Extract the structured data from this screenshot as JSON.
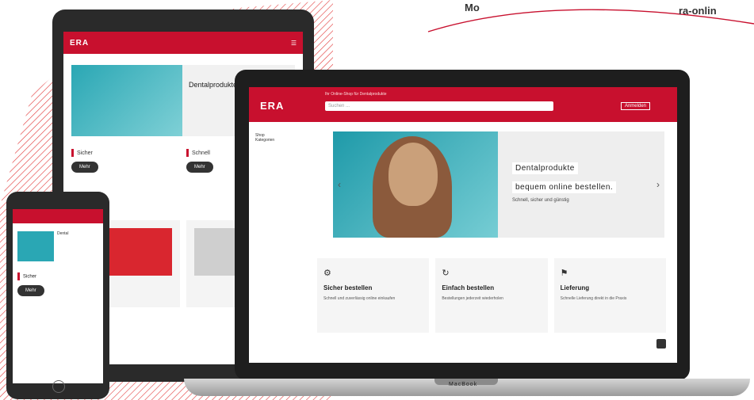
{
  "banner_text": {
    "left": "Mo",
    "right": "ra-onlin"
  },
  "colors": {
    "brand_red": "#c8102e",
    "teal": "#2aa7b4"
  },
  "tablet": {
    "hero_title": "Dentalprodukte",
    "cards": [
      {
        "title": "Sicher",
        "button": "Mehr"
      },
      {
        "title": "Schnell",
        "button": "Mehr"
      }
    ]
  },
  "phone": {
    "hero_title": "Dental",
    "card_title": "Sicher",
    "button": "Mehr"
  },
  "laptop": {
    "logo": "ERA",
    "tagline": "Ihr Online-Shop für Dentalprodukte",
    "search_placeholder": "Suchen ...",
    "login_label": "Anmelden",
    "sidebar_items": [
      "Shop",
      "Kategorien"
    ],
    "hero_line1": "Dentalprodukte",
    "hero_line2": "bequem online bestellen.",
    "hero_sub": "Schnell, sicher und günstig",
    "cards": [
      {
        "icon": "⚙",
        "title": "Sicher bestellen",
        "desc": "Schnell und zuverlässig online einkaufen"
      },
      {
        "icon": "↻",
        "title": "Einfach bestellen",
        "desc": "Bestellungen jederzeit wiederholen"
      },
      {
        "icon": "⚑",
        "title": "Lieferung",
        "desc": "Schnelle Lieferung direkt in die Praxis"
      }
    ],
    "brand_label": "MacBook"
  }
}
